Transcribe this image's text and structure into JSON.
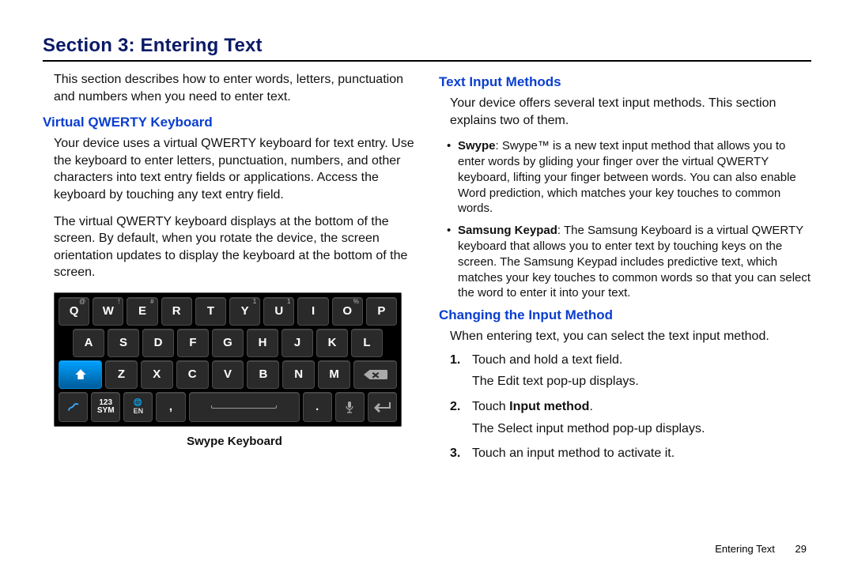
{
  "section_title": "Section 3: Entering Text",
  "left": {
    "intro": "This section describes how to enter words, letters, punctuation and numbers when you need to enter text.",
    "h_qwerty": "Virtual QWERTY Keyboard",
    "p_qwerty_1": "Your device uses a virtual QWERTY keyboard for text entry. Use the keyboard to enter letters, punctuation, numbers, and other characters into text entry fields or applications. Access the keyboard by touching any text entry field.",
    "p_qwerty_2": "The virtual QWERTY keyboard displays at the bottom of the screen. By default, when you rotate the device, the screen orientation updates to display the keyboard at the bottom of the screen.",
    "kb_caption": "Swype Keyboard"
  },
  "right": {
    "h_methods": "Text Input Methods",
    "p_methods": "Your device offers several text input methods. This section explains two of them.",
    "bullets": [
      {
        "name": "Swype",
        "text": ": Swype™ is a new text input method that allows you to enter words by gliding your finger over the virtual QWERTY keyboard, lifting your finger between words. You can also enable Word prediction, which matches your key touches to common words."
      },
      {
        "name": "Samsung Keypad",
        "text": ": The Samsung Keyboard is a virtual QWERTY keyboard that allows you to enter text by touching keys on the screen. The Samsung Keypad includes predictive text, which matches your key touches to common words so that you can select the word to enter it into your text."
      }
    ],
    "h_change": "Changing the Input Method",
    "p_change": "When entering text, you can select the text input method.",
    "steps": [
      {
        "num": "1.",
        "main": "Touch and hold a text field.",
        "sub": "The Edit text pop-up displays."
      },
      {
        "num": "2.",
        "main_pre": "Touch ",
        "main_bold": "Input method",
        "main_post": ".",
        "sub": "The Select input method pop-up displays."
      },
      {
        "num": "3.",
        "main": "Touch an input method to activate it."
      }
    ]
  },
  "keyboard": {
    "row1": [
      {
        "l": "Q",
        "s": "@"
      },
      {
        "l": "W",
        "s": "!"
      },
      {
        "l": "E",
        "s": "#"
      },
      {
        "l": "R",
        "s": ""
      },
      {
        "l": "T",
        "s": ""
      },
      {
        "l": "Y",
        "s": "1"
      },
      {
        "l": "U",
        "s": "1"
      },
      {
        "l": "I",
        "s": ""
      },
      {
        "l": "O",
        "s": "%"
      },
      {
        "l": "P",
        "s": " "
      }
    ],
    "row2": [
      {
        "l": "A",
        "s": ""
      },
      {
        "l": "S",
        "s": ""
      },
      {
        "l": "D",
        "s": ""
      },
      {
        "l": "F",
        "s": ""
      },
      {
        "l": "G",
        "s": ""
      },
      {
        "l": "H",
        "s": ""
      },
      {
        "l": "J",
        "s": ""
      },
      {
        "l": "K",
        "s": ""
      },
      {
        "l": "L",
        "s": ""
      }
    ],
    "row3_mid": [
      {
        "l": "Z"
      },
      {
        "l": "X"
      },
      {
        "l": "C"
      },
      {
        "l": "V"
      },
      {
        "l": "B"
      },
      {
        "l": "N"
      },
      {
        "l": "M"
      }
    ],
    "sym_label": "123\nSYM",
    "globe_label": "EN",
    "comma": ",",
    "period": "."
  },
  "footer": {
    "chapter": "Entering Text",
    "page": "29"
  }
}
